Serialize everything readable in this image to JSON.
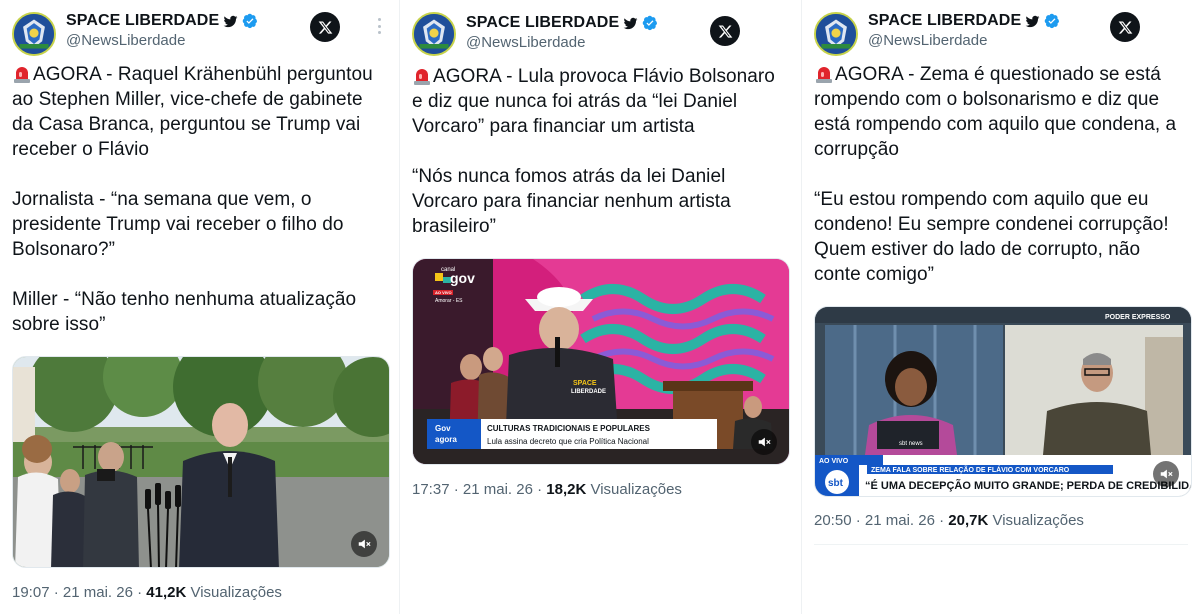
{
  "tweets": [
    {
      "author": "SPACE LIBERDADE",
      "handle": "@NewsLiberdade",
      "lines": [
        "AGORA - Raquel Krähenbühl perguntou",
        "ao Stephen Miller, vice-chefe de gabinete",
        "da Casa Branca, perguntou se Trump vai",
        "receber o Flávio",
        "",
        "Jornalista - “na semana que vem, o",
        "presidente Trump vai receber o filho do",
        "Bolsonaro?”",
        "",
        "Miller - “Não tenho nenhuma atualização",
        "sobre isso”"
      ],
      "time": "19:07",
      "date": "21 mai. 26",
      "views": "41,2K",
      "views_label": "Visualizações"
    },
    {
      "author": "SPACE LIBERDADE",
      "handle": "@NewsLiberdade",
      "lines": [
        "AGORA - Lula provoca Flávio Bolsonaro",
        "e diz que nunca foi atrás da “lei Daniel",
        "Vorcaro” para financiar um artista",
        "",
        "“Nós nunca fomos atrás da lei Daniel",
        "Vorcaro para financiar nenhum artista",
        "brasileiro”"
      ],
      "media": {
        "channel_top": "canal",
        "channel": "gov",
        "live_tag": "AO VIVO",
        "location": "Amorar - ES",
        "gov_logo_top": "Gov",
        "gov_logo_bottom": "agora",
        "headline": "CULTURAS TRADICIONAIS E POPULARES",
        "subline": "Lula assina decreto que cria Política Nacional",
        "watermark_top": "SPACE",
        "watermark_bottom": "LIBERDADE"
      },
      "time": "17:37",
      "date": "21 mai. 26",
      "views": "18,2K",
      "views_label": "Visualizações"
    },
    {
      "author": "SPACE LIBERDADE",
      "handle": "@NewsLiberdade",
      "lines": [
        "AGORA - Zema é questionado se está",
        "rompendo com o bolsonarismo e diz que",
        "está rompendo com aquilo que condena, a",
        "corrupção",
        "",
        "“Eu estou rompendo com aquilo que eu",
        "condeno! Eu sempre condenei corrupção!",
        "Quem estiver do lado de corrupto, não",
        "conte comigo”"
      ],
      "media": {
        "corner_tag": "PODER EXPRESSO",
        "live_tag": "AO VIVO",
        "topic": "ZEMA FALA SOBRE RELAÇÃO DE FLÁVIO COM VORCARO",
        "headline": "“É UMA DECEPÇÃO MUITO GRANDE; PERDA DE CREDIBILIDADE",
        "network": "sbt",
        "monitor_label": "sbt news"
      },
      "time": "20:50",
      "date": "21 mai. 26",
      "views": "20,7K",
      "views_label": "Visualizações"
    }
  ],
  "separator": " · ",
  "icons": {
    "verified": "verified-badge-icon",
    "bird": "twitter-bird-icon",
    "x_logo": "x-logo-icon",
    "more": "more-dots-icon",
    "siren": "siren-emoji-icon",
    "mute": "muted-speaker-icon"
  },
  "colors": {
    "text": "#0f1419",
    "secondary": "#536471",
    "verified": "#1d9bf0",
    "siren": "#e0242c",
    "gov_magenta": "#e0227e",
    "sbt_blue": "#1457c6"
  }
}
